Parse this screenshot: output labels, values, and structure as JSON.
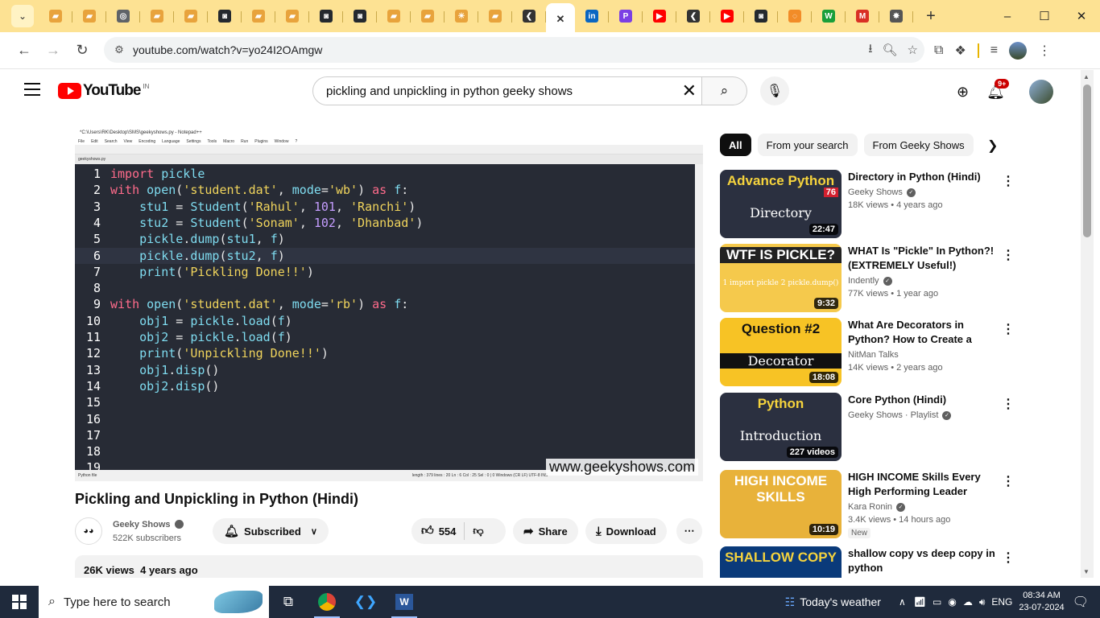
{
  "browser": {
    "url": "youtube.com/watch?v=yo24I2OAmgw",
    "tabs": [
      {
        "icon": "note-icon",
        "color": "#e8a33c"
      },
      {
        "icon": "note-icon",
        "color": "#e8a33c"
      },
      {
        "icon": "globe-icon",
        "color": "#5f6368"
      },
      {
        "icon": "note-icon",
        "color": "#e8a33c"
      },
      {
        "icon": "note-icon",
        "color": "#e8a33c"
      },
      {
        "icon": "github-icon",
        "color": "#24292f"
      },
      {
        "icon": "note-icon",
        "color": "#e8a33c"
      },
      {
        "icon": "note-icon",
        "color": "#e8a33c"
      },
      {
        "icon": "github-icon",
        "color": "#24292f"
      },
      {
        "icon": "github-icon",
        "color": "#24292f"
      },
      {
        "icon": "note-icon",
        "color": "#e8a33c"
      },
      {
        "icon": "note-icon",
        "color": "#e8a33c"
      },
      {
        "icon": "sun-icon",
        "color": "#e8a33c"
      },
      {
        "icon": "note-icon",
        "color": "#e8a33c"
      },
      {
        "icon": "code-icon",
        "color": "#333333"
      },
      {
        "icon": "close-icon",
        "color": "#333333",
        "active": true
      },
      {
        "icon": "linkedin-icon",
        "color": "#0a66c2"
      },
      {
        "icon": "p-icon",
        "color": "#7b3fe4"
      },
      {
        "icon": "youtube-icon",
        "color": "#ff0000"
      },
      {
        "icon": "code-icon",
        "color": "#333333"
      },
      {
        "icon": "youtube-icon",
        "color": "#ff0000"
      },
      {
        "icon": "github-icon",
        "color": "#24292f"
      },
      {
        "icon": "ring-icon",
        "color": "#f28c28"
      },
      {
        "icon": "w-icon",
        "color": "#1a9e3a"
      },
      {
        "icon": "gmail-icon",
        "color": "#d93025"
      },
      {
        "icon": "openai-icon",
        "color": "#555555"
      }
    ]
  },
  "youtube": {
    "logo_text": "YouTube",
    "country": "IN",
    "search_query": "pickling and unpickling in python geeky shows",
    "notif_count": "9+"
  },
  "editor": {
    "title": "*C:\\Users\\RK\\Desktop\\SMS\\geekyshows.py - Notepad++",
    "menu": [
      "File",
      "Edit",
      "Search",
      "View",
      "Encoding",
      "Language",
      "Settings",
      "Tools",
      "Macro",
      "Run",
      "Plugins",
      "Window",
      "?"
    ],
    "tabs": "geekyshows.py",
    "status": "Python file",
    "status_right": "length : 379   lines : 20      Ln : 6   Col : 25   Sel : 0 | 0        Windows (CR LF)    UTF-8        INS",
    "watermark": "www.geekyshows.com",
    "lines": [
      {
        "n": "1",
        "html": "<span class='kw'>import</span> <span class='fn'>pickle</span>"
      },
      {
        "n": "2",
        "html": "<span class='kw'>with</span> <span class='fn'>open</span><span class='tx'>(</span><span class='st'>'student.dat'</span><span class='tx'>, </span><span class='fn'>mode</span><span class='tx'>=</span><span class='st'>'wb'</span><span class='tx'>) </span><span class='kw'>as</span> <span class='fn'>f</span><span class='tx'>:</span>"
      },
      {
        "n": "3",
        "html": "    <span class='fn'>stu1</span> <span class='tx'>= </span><span class='fn'>Student</span><span class='tx'>(</span><span class='st'>'Rahul'</span><span class='tx'>, </span><span class='nm'>101</span><span class='tx'>, </span><span class='st'>'Ranchi'</span><span class='tx'>)</span>"
      },
      {
        "n": "4",
        "html": "    <span class='fn'>stu2</span> <span class='tx'>= </span><span class='fn'>Student</span><span class='tx'>(</span><span class='st'>'Sonam'</span><span class='tx'>, </span><span class='nm'>102</span><span class='tx'>, </span><span class='st'>'Dhanbad'</span><span class='tx'>)</span>"
      },
      {
        "n": "5",
        "html": "    <span class='fn'>pickle</span><span class='tx'>.</span><span class='fn'>dump</span><span class='tx'>(</span><span class='fn'>stu1</span><span class='tx'>, </span><span class='fn'>f</span><span class='tx'>)</span>"
      },
      {
        "n": "6",
        "html": "    <span class='fn'>pickle</span><span class='tx'>.</span><span class='fn'>dump</span><span class='tx'>(</span><span class='fn'>stu2</span><span class='tx'>, </span><span class='fn'>f</span><span class='tx'>)</span>",
        "current": true
      },
      {
        "n": "7",
        "html": "    <span class='fn'>print</span><span class='tx'>(</span><span class='st'>'Pickling Done!!'</span><span class='tx'>)</span>"
      },
      {
        "n": "8",
        "html": ""
      },
      {
        "n": "9",
        "html": "<span class='kw'>with</span> <span class='fn'>open</span><span class='tx'>(</span><span class='st'>'student.dat'</span><span class='tx'>, </span><span class='fn'>mode</span><span class='tx'>=</span><span class='st'>'rb'</span><span class='tx'>) </span><span class='kw'>as</span> <span class='fn'>f</span><span class='tx'>:</span>"
      },
      {
        "n": "10",
        "html": "    <span class='fn'>obj1</span> <span class='tx'>= </span><span class='fn'>pickle</span><span class='tx'>.</span><span class='fn'>load</span><span class='tx'>(</span><span class='fn'>f</span><span class='tx'>)</span>"
      },
      {
        "n": "11",
        "html": "    <span class='fn'>obj2</span> <span class='tx'>= </span><span class='fn'>pickle</span><span class='tx'>.</span><span class='fn'>load</span><span class='tx'>(</span><span class='fn'>f</span><span class='tx'>)</span>"
      },
      {
        "n": "12",
        "html": "    <span class='fn'>print</span><span class='tx'>(</span><span class='st'>'Unpickling Done!!'</span><span class='tx'>)</span>"
      },
      {
        "n": "13",
        "html": "    <span class='fn'>obj1</span><span class='tx'>.</span><span class='fn'>disp</span><span class='tx'>()</span>"
      },
      {
        "n": "14",
        "html": "    <span class='fn'>obj2</span><span class='tx'>.</span><span class='fn'>disp</span><span class='tx'>()</span>"
      },
      {
        "n": "15",
        "html": ""
      },
      {
        "n": "16",
        "html": ""
      },
      {
        "n": "17",
        "html": ""
      },
      {
        "n": "18",
        "html": ""
      },
      {
        "n": "19",
        "html": ""
      }
    ]
  },
  "video": {
    "title": "Pickling and Unpickling in Python (Hindi)",
    "channel": "Geeky Shows",
    "subscribers": "522K subscribers",
    "subscribe_label": "Subscribed",
    "likes": "554",
    "share_label": "Share",
    "download_label": "Download",
    "views": "26K views",
    "age": "4 years ago"
  },
  "chips": [
    "All",
    "From your search",
    "From Geeky Shows"
  ],
  "recommendations": [
    {
      "title": "Directory in Python (Hindi)",
      "channel": "Geeky Shows",
      "meta": "18K views • 4 years ago",
      "duration": "22:47",
      "thumb_bg": "#2b3040",
      "thumb_top": "Advance Python",
      "thumb_mid": "Directory",
      "badge": "76",
      "verified": true
    },
    {
      "title": "WHAT Is \"Pickle\" In Python?! (EXTREMELY Useful!)",
      "channel": "Indently",
      "meta": "77K views • 1 year ago",
      "duration": "9:32",
      "thumb_bg": "#f5c94c",
      "thumb_top": "WTF IS PICKLE?",
      "thumb_mid": "1 import pickle  2 pickle.dump()",
      "verified": true
    },
    {
      "title": "What Are Decorators in Python? How to Create a Python...",
      "channel": "NitMan Talks",
      "meta": "14K views • 2 years ago",
      "duration": "18:08",
      "thumb_bg": "#f7c325",
      "thumb_top": "Question #2",
      "thumb_mid": "Decorator",
      "verified": false
    },
    {
      "title": "Core Python (Hindi)",
      "channel": "Geeky Shows · Playlist",
      "meta": "",
      "duration": "227 videos",
      "thumb_bg": "#2b3040",
      "thumb_top": "Python",
      "thumb_mid": "Introduction",
      "verified": true
    },
    {
      "title": "HIGH INCOME Skills Every High Performing Leader NEEDS to...",
      "channel": "Kara Ronin",
      "meta": "3.4K views • 14 hours ago",
      "duration": "10:19",
      "thumb_bg": "#e8b23a",
      "thumb_top": "HIGH INCOME SKILLS",
      "thumb_mid": "",
      "verified": true,
      "new": "New"
    },
    {
      "title": "shallow copy vs deep copy in python",
      "channel": "",
      "meta": "",
      "duration": "",
      "thumb_bg": "#0a3a7a",
      "thumb_top": "SHALLOW COPY",
      "thumb_mid": "",
      "verified": false
    }
  ],
  "taskbar": {
    "search_placeholder": "Type here to search",
    "weather": "Today's weather",
    "lang": "ENG",
    "time": "08:34 AM",
    "date": "23-07-2024"
  }
}
